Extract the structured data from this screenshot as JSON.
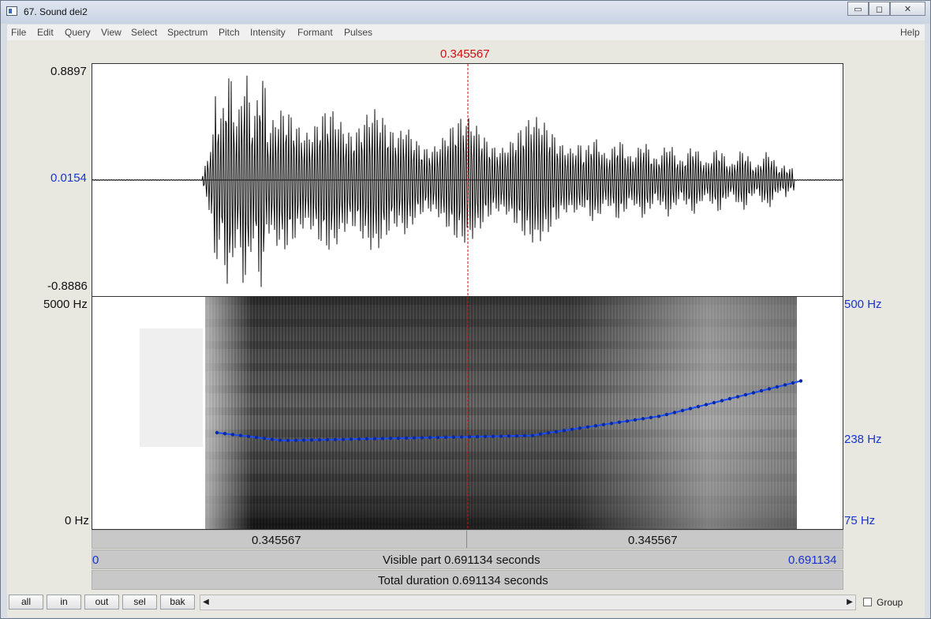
{
  "window": {
    "title": "67. Sound dei2",
    "controls": [
      "▭",
      "◻",
      "✕"
    ]
  },
  "menu": {
    "items": [
      "File",
      "Edit",
      "Query",
      "View",
      "Select",
      "Spectrum",
      "Pitch",
      "Intensity",
      "Formant",
      "Pulses"
    ],
    "help": "Help"
  },
  "cursor": {
    "time_label": "0.345567"
  },
  "waveform": {
    "ymax": "0.8897",
    "ymid": "0.0154",
    "ymin": "-0.8886"
  },
  "spectrogram": {
    "freq_top": "5000 Hz",
    "freq_bottom": "0 Hz"
  },
  "pitch_axis": {
    "top": "500 Hz",
    "mid": "238 Hz",
    "bottom": "75 Hz"
  },
  "time_bars": {
    "left_segment": "0.345567",
    "right_segment": "0.345567",
    "visible_start": "0",
    "visible_label": "Visible part 0.691134 seconds",
    "visible_end": "0.691134",
    "total_label": "Total duration 0.691134 seconds"
  },
  "buttons": {
    "all": "all",
    "in": "in",
    "out": "out",
    "sel": "sel",
    "bak": "bak"
  },
  "group": {
    "label": "Group"
  },
  "colors": {
    "pitch_line": "#1a4cff",
    "cursor": "#d01010",
    "axis_blue": "#1a33cc"
  }
}
